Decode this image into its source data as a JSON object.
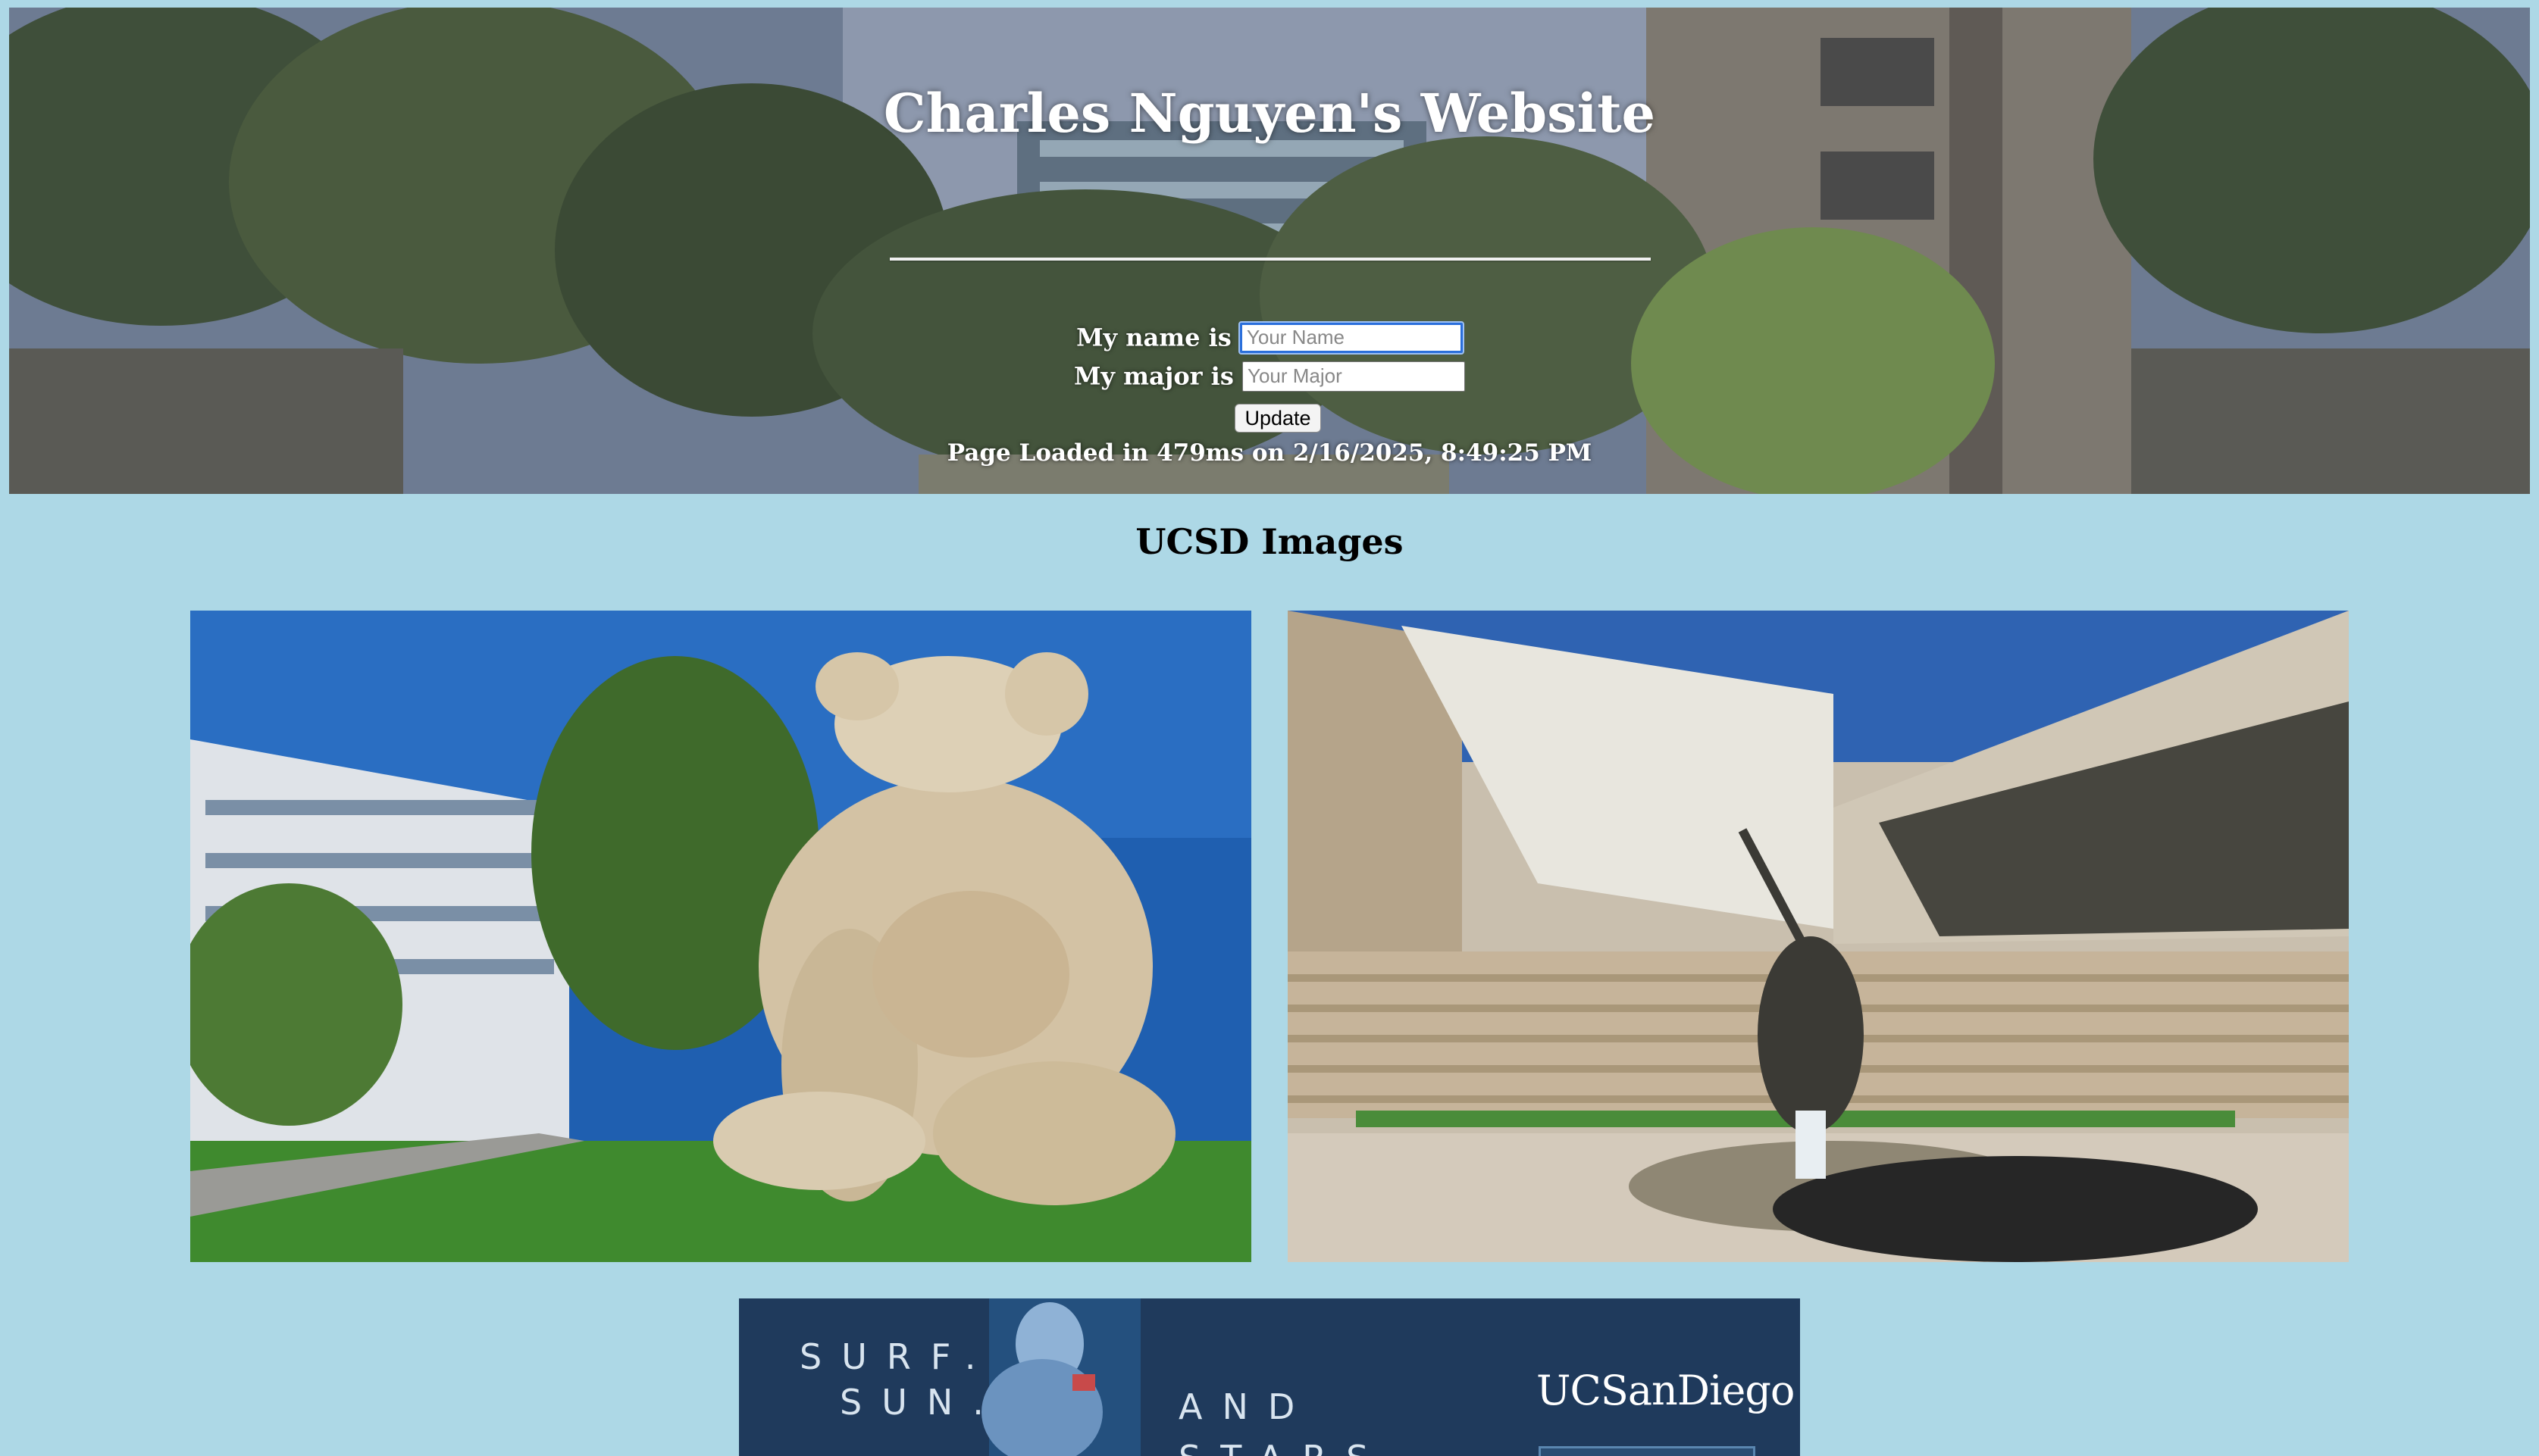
{
  "header": {
    "title": "Charles Nguyen's Website",
    "name_label": "My name is",
    "name_placeholder": "Your Name",
    "major_label": "My major is",
    "major_placeholder": "Your Major",
    "update_label": "Update",
    "load_info": "Page Loaded in 479ms on 2/16/2025, 8:49:25 PM"
  },
  "section": {
    "title": "UCSD Images"
  },
  "banner": {
    "line1": "SURF.",
    "line2": "SUN.",
    "line3": "AND",
    "line4": "STARS",
    "logo": "UCSanDiego"
  },
  "colors": {
    "page_background": "#add8e6",
    "focus_ring": "#2a6fdb",
    "banner_navy": "#1f3a5c"
  }
}
